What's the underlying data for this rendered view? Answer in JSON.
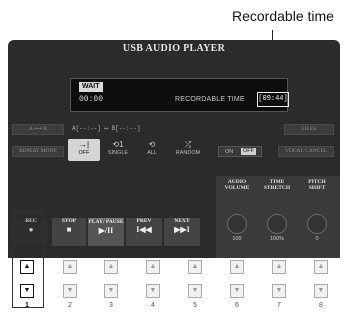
{
  "callout": {
    "label": "Recordable time"
  },
  "player": {
    "title": "USB AUDIO PLAYER",
    "display": {
      "status_badge": "WAIT",
      "time": "00:00",
      "recordable_label": "RECORDABLE TIME",
      "recordable_value": "[09:44]"
    },
    "ab_button": "A ⟷ B",
    "ab_range": "A[--:--] ⟷ B[--:--]",
    "files_button": "FILES",
    "repeat_button": "REPEAT MODE",
    "repeat_options": [
      {
        "label": "OFF",
        "icon": "→|"
      },
      {
        "label": "SINGLE",
        "icon": "⟲1"
      },
      {
        "label": "ALL",
        "icon": "⟲"
      },
      {
        "label": "RANDOM",
        "icon": "⤮"
      }
    ],
    "vocal_cancel_toggle": {
      "on": "ON",
      "off": "OFF"
    },
    "vocal_cancel_button": "VOCAL CANCEL",
    "knobs": [
      {
        "label": "AUDIO VOLUME",
        "value": "100"
      },
      {
        "label": "TIME STRETCH",
        "value": "100%"
      },
      {
        "label": "PITCH SHIFT",
        "value": "0"
      }
    ],
    "transport": [
      {
        "label": "REC",
        "icon": "●"
      },
      {
        "label": "STOP",
        "icon": "■"
      },
      {
        "label": "PLAY/ PAUSE",
        "icon": "▶/II"
      },
      {
        "label": "PREV",
        "icon": "I◀◀"
      },
      {
        "label": "NEXT",
        "icon": "▶▶I"
      }
    ]
  },
  "hardware": {
    "up_symbol": "▲",
    "down_symbol": "▼",
    "numbers": [
      "1",
      "2",
      "3",
      "4",
      "5",
      "6",
      "7",
      "8"
    ]
  }
}
